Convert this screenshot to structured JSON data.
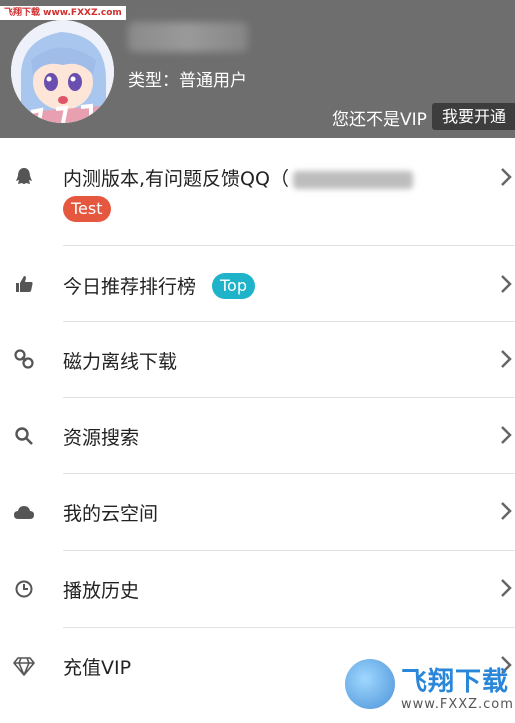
{
  "watermark_top": "飞翔下载 www.FXXZ.com",
  "header": {
    "user_type": "类型：普通用户",
    "vip_status": "您还不是VIP",
    "open_vip_button": "我要开通"
  },
  "menu": {
    "items": [
      {
        "label": "内测版本,有问题反馈QQ（",
        "badge": "Test",
        "badge_color": "#e5573f",
        "icon": "qq-penguin-icon"
      },
      {
        "label": "今日推荐排行榜",
        "badge": "Top",
        "badge_color": "#1fb3c9",
        "icon": "thumbs-up-icon"
      },
      {
        "label": "磁力离线下载",
        "icon": "link-icon"
      },
      {
        "label": "资源搜索",
        "icon": "search-icon"
      },
      {
        "label": "我的云空间",
        "icon": "cloud-icon"
      },
      {
        "label": "播放历史",
        "icon": "clock-icon"
      },
      {
        "label": "充值VIP",
        "icon": "diamond-icon"
      }
    ]
  },
  "watermark_logo": {
    "name": "飞翔下载",
    "url": "www.FXXZ.com"
  }
}
